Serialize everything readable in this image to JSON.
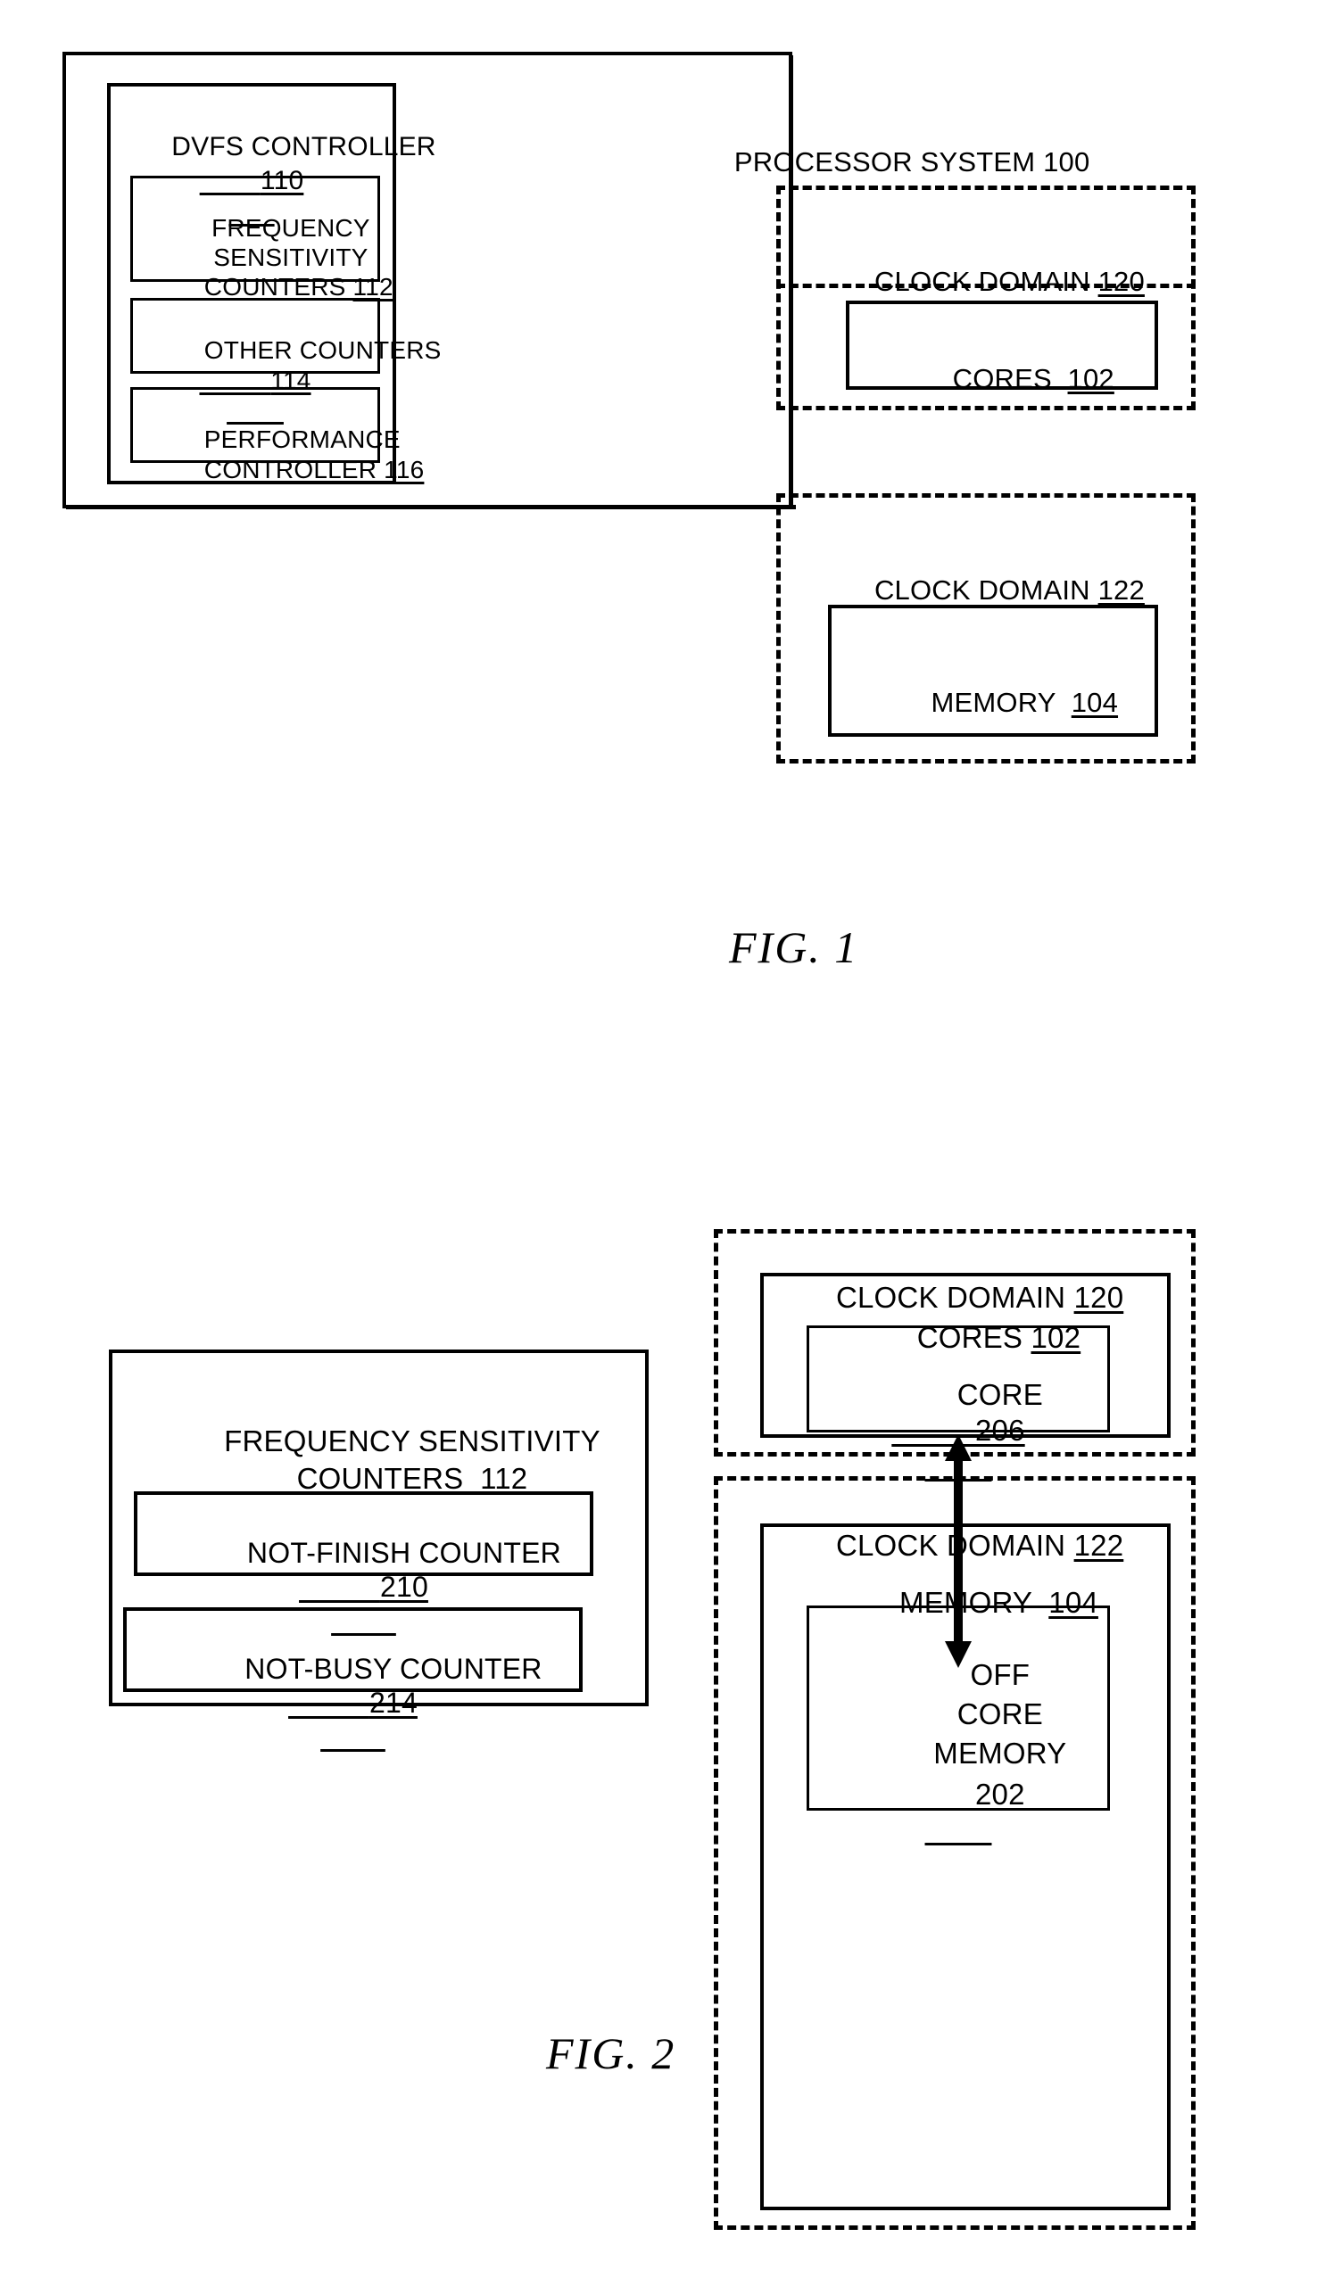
{
  "document": {
    "kind": "patent-drawing-sheet",
    "figures": [
      {
        "caption": "FIG. 1",
        "system_label": "PROCESSOR SYSTEM",
        "system_numeral": "100",
        "blocks": {
          "dvfs_controller": {
            "title": "DVFS CONTROLLER",
            "numeral": "110",
            "children": [
              {
                "lines": [
                  "FREQUENCY",
                  "SENSITIVITY",
                  "COUNTERS  112"
                ],
                "label": "FREQUENCY SENSITIVITY COUNTERS",
                "numeral": "112"
              },
              {
                "lines": [
                  "OTHER COUNTERS",
                  "114"
                ],
                "label": "OTHER COUNTERS",
                "numeral": "114"
              },
              {
                "lines": [
                  "PERFORMANCE",
                  "CONTROLLER  116"
                ],
                "label": "PERFORMANCE CONTROLLER",
                "numeral": "116"
              }
            ]
          },
          "clock_domain_upper": {
            "title": "CLOCK DOMAIN",
            "numeral": "120",
            "child": {
              "title": "CORES",
              "numeral": "102"
            }
          },
          "clock_domain_lower": {
            "title": "CLOCK DOMAIN",
            "numeral": "122",
            "child": {
              "title": "MEMORY",
              "numeral": "104"
            }
          }
        }
      },
      {
        "caption": "FIG. 2",
        "blocks": {
          "freq_sens_counters": {
            "title_line1": "FREQUENCY SENSITIVITY",
            "title_line2": "COUNTERS",
            "numeral": "112",
            "children": [
              {
                "title": "NOT-FINISH COUNTER",
                "numeral": "210"
              },
              {
                "title": "NOT-BUSY COUNTER",
                "numeral": "214"
              }
            ]
          },
          "clock_domain_upper": {
            "title": "CLOCK DOMAIN",
            "numeral": "120",
            "child": {
              "title": "CORES",
              "numeral": "102",
              "child": {
                "title": "CORE",
                "numeral": "206"
              }
            }
          },
          "clock_domain_lower": {
            "title": "CLOCK DOMAIN",
            "numeral": "122",
            "child": {
              "title": "MEMORY",
              "numeral": "104",
              "child": {
                "lines": [
                  "OFF",
                  "CORE",
                  "MEMORY"
                ],
                "numeral": "202"
              }
            }
          },
          "connector": {
            "kind": "double-headed-arrow",
            "orientation": "vertical"
          }
        }
      }
    ],
    "colors": {
      "ink": "#000000",
      "paper": "#ffffff"
    }
  }
}
